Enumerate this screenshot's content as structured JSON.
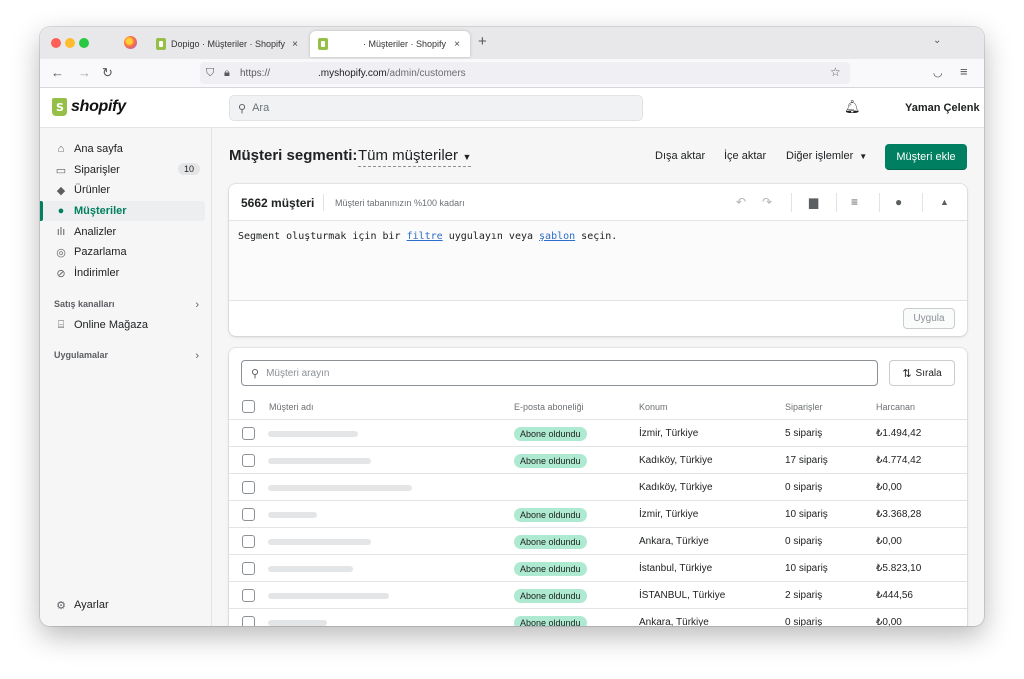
{
  "browser": {
    "tabs": [
      {
        "title": "Dopigo · Müşteriler · Shopify",
        "close": "×"
      },
      {
        "title": "· Müşteriler · Shopify",
        "close": "×"
      }
    ],
    "new_tab": "+",
    "tab_menu": "⌄",
    "url_prefix": "https://",
    "url_domain": ".myshopify.com",
    "url_path": "/admin/customers"
  },
  "shopify": {
    "logo_text": "shopify",
    "search_placeholder": "Ara",
    "user_name": "Yaman Çelenk"
  },
  "sidebar": {
    "items": [
      {
        "label": "Ana sayfa",
        "icon": "home-icon"
      },
      {
        "label": "Siparişler",
        "icon": "orders-icon",
        "badge": "10"
      },
      {
        "label": "Ürünler",
        "icon": "tag-icon"
      },
      {
        "label": "Müşteriler",
        "icon": "person-icon",
        "active": true
      },
      {
        "label": "Analizler",
        "icon": "bar-chart-icon"
      },
      {
        "label": "Pazarlama",
        "icon": "target-icon"
      },
      {
        "label": "İndirimler",
        "icon": "discount-icon"
      }
    ],
    "sales_channels": "Satış kanalları",
    "online_store": "Online Mağaza",
    "apps": "Uygulamalar",
    "settings": "Ayarlar"
  },
  "header": {
    "title": "Müşteri segmenti:",
    "segment": "Tüm müşteriler",
    "export": "Dışa aktar",
    "import": "İçe aktar",
    "more_actions": "Diğer işlemler",
    "add_customer": "Müşteri ekle"
  },
  "segment": {
    "count": "5662 müşteri",
    "note": "Müşteri tabanınızın %100 kadarı",
    "editor": {
      "before": "Segment oluşturmak için bir ",
      "link1": "filtre",
      "middle": " uygulayın veya ",
      "link2": "şablon",
      "after": " seçin."
    },
    "apply": "Uygula"
  },
  "customers": {
    "search_placeholder": "Müşteri arayın",
    "sort": "Sırala",
    "columns": [
      "Müşteri adı",
      "E-posta aboneliği",
      "Konum",
      "Siparişler",
      "Harcanan"
    ],
    "rows": [
      {
        "subscribed": "Abone oldundu",
        "location": "İzmir, Türkiye",
        "orders": "5 sipariş",
        "spent": "₺1.494,42",
        "name_w": 0.5
      },
      {
        "subscribed": "Abone oldundu",
        "location": "Kadıköy, Türkiye",
        "orders": "17 sipariş",
        "spent": "₺4.774,42",
        "name_w": 0.57
      },
      {
        "subscribed": "",
        "location": "Kadıköy, Türkiye",
        "orders": "0 sipariş",
        "spent": "₺0,00",
        "name_w": 0.8
      },
      {
        "subscribed": "Abone oldundu",
        "location": "İzmir, Türkiye",
        "orders": "10 sipariş",
        "spent": "₺3.368,28",
        "name_w": 0.27
      },
      {
        "subscribed": "Abone oldundu",
        "location": "Ankara, Türkiye",
        "orders": "0 sipariş",
        "spent": "₺0,00",
        "name_w": 0.57
      },
      {
        "subscribed": "Abone oldundu",
        "location": "İstanbul, Türkiye",
        "orders": "10 sipariş",
        "spent": "₺5.823,10",
        "name_w": 0.47
      },
      {
        "subscribed": "Abone oldundu",
        "location": "İSTANBUL, Türkiye",
        "orders": "2 sipariş",
        "spent": "₺444,56",
        "name_w": 0.67
      },
      {
        "subscribed": "Abone oldundu",
        "location": "Ankara, Türkiye",
        "orders": "0 sipariş",
        "spent": "₺0,00",
        "name_w": 0.33
      }
    ]
  },
  "colors": {
    "accent": "#008060",
    "badge_green": "#aee9d1",
    "brand": "#95bf47"
  }
}
